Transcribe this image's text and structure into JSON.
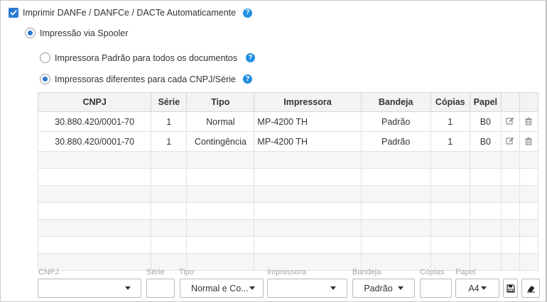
{
  "options": {
    "auto_print_label": "Imprimir DANFe / DANFCe / DACTe Automaticamente",
    "spooler_label": "Impressão via Spooler",
    "default_printer_label": "Impressora Padrão para todos os documentos",
    "diff_printers_label": "Impressoras diferentes para cada CNPJ/Série"
  },
  "table": {
    "columns": [
      "CNPJ",
      "Série",
      "Tipo",
      "Impressora",
      "Bandeja",
      "Cópias",
      "Papel",
      "",
      ""
    ],
    "rows": [
      {
        "cnpj": "30.880.420/0001-70",
        "serie": "1",
        "tipo": "Normal",
        "impressora": "MP-4200 TH",
        "bandeja": "Padrão",
        "copias": "1",
        "papel": "B0"
      },
      {
        "cnpj": "30.880.420/0001-70",
        "serie": "1",
        "tipo": "Contingência",
        "impressora": "MP-4200 TH",
        "bandeja": "Padrão",
        "copias": "1",
        "papel": "B0"
      }
    ]
  },
  "form": {
    "cnpj_label": "CNPJ",
    "cnpj_value": "",
    "serie_label": "Série",
    "serie_value": "",
    "tipo_label": "Tipo",
    "tipo_value": "Normal e Co...",
    "impressora_label": "Impressora",
    "impressora_value": "",
    "bandeja_label": "Bandeja",
    "bandeja_value": "Padrão",
    "copias_label": "Cópias",
    "copias_value": "",
    "papel_label": "Papel",
    "papel_value": "A4"
  },
  "icons": {
    "help": "help-circle-icon",
    "edit": "edit-icon",
    "delete": "trash-icon",
    "save": "floppy-disk-icon",
    "clear": "eraser-icon"
  },
  "colors": {
    "accent": "#2b7bd0",
    "help": "#1e8fe0"
  }
}
